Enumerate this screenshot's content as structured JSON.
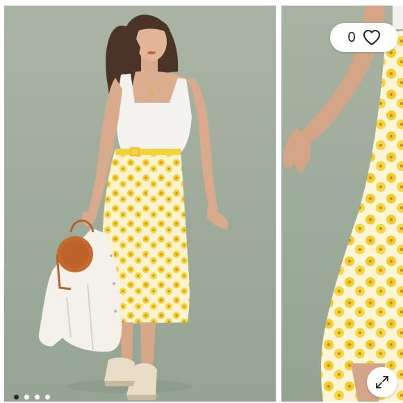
{
  "gallery": {
    "like_count": "0",
    "slide_count": 4,
    "active_slide": 1,
    "icons": {
      "like": "heart-icon",
      "expand": "expand-arrows-icon"
    },
    "colors": {
      "backdrop": "#a1ad9e",
      "skirt_yellow": "#f3d23a",
      "active_dot": "#2b2b2b",
      "inactive_dot": "#ffffff"
    }
  }
}
